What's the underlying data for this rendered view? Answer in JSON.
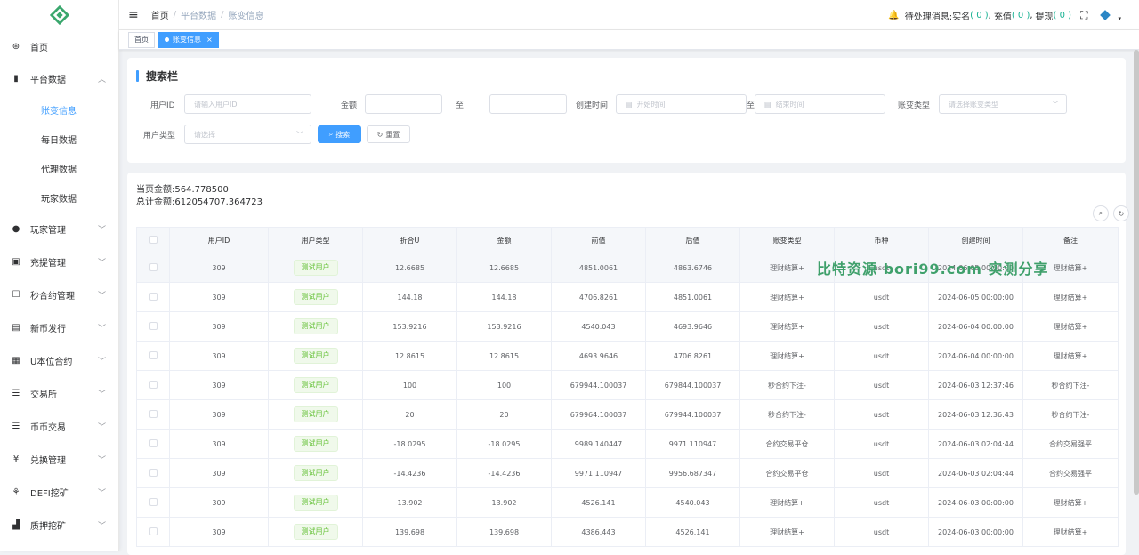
{
  "sidebar": {
    "items": [
      {
        "label": "首页",
        "icon": "dashboard-icon"
      },
      {
        "label": "平台数据",
        "icon": "chart-icon",
        "expanded": true,
        "children": [
          "账变信息",
          "每日数据",
          "代理数据",
          "玩家数据"
        ]
      },
      {
        "label": "玩家管理",
        "icon": "user-icon"
      },
      {
        "label": "充提管理",
        "icon": "wallet-icon"
      },
      {
        "label": "秒合约管理",
        "icon": "contract-icon"
      },
      {
        "label": "新币发行",
        "icon": "coin-icon"
      },
      {
        "label": "U本位合约",
        "icon": "grid-icon"
      },
      {
        "label": "交易所",
        "icon": "list-icon"
      },
      {
        "label": "币币交易",
        "icon": "list2-icon"
      },
      {
        "label": "兑换管理",
        "icon": "yen-icon"
      },
      {
        "label": "DEFI挖矿",
        "icon": "defi-icon"
      },
      {
        "label": "质押挖矿",
        "icon": "bar-chart-icon"
      }
    ],
    "active_sub": "账变信息"
  },
  "topbar": {
    "breadcrumb": [
      "首页",
      "平台数据",
      "账变信息"
    ],
    "pending_label": "待处理消息:",
    "realname_label": "实名",
    "realname_count": "( 0 )",
    "recharge_label": "充值",
    "recharge_count": "( 0 )",
    "withdraw_label": "提现",
    "withdraw_count": "( 0 )",
    "sep1": ",",
    "sep2": ","
  },
  "tags": {
    "home": "首页",
    "current": "账变信息"
  },
  "search": {
    "title": "搜索栏",
    "user_id_label": "用户ID",
    "user_id_placeholder": "请输入用户ID",
    "amount_label": "金额",
    "to_label": "至",
    "create_time_label": "创建时间",
    "start_placeholder": "开始时间",
    "end_placeholder": "结束时间",
    "change_type_label": "账变类型",
    "change_type_placeholder": "请选择账变类型",
    "user_type_label": "用户类型",
    "user_type_placeholder": "请选择",
    "search_btn": "搜索",
    "reset_btn": "重置"
  },
  "summary": {
    "page_amount": "当页金额:564.778500",
    "total_amount": "总计金额:612054707.364723"
  },
  "table": {
    "headers": [
      "用户ID",
      "用户类型",
      "折合U",
      "金额",
      "前值",
      "后值",
      "账变类型",
      "币种",
      "创建时间",
      "备注"
    ],
    "rows": [
      [
        "309",
        "测试用户",
        "12.6685",
        "12.6685",
        "4851.0061",
        "4863.6746",
        "理财结算+",
        "usdt",
        "2024-06-05 00:00:00",
        "理财结算+"
      ],
      [
        "309",
        "测试用户",
        "144.18",
        "144.18",
        "4706.8261",
        "4851.0061",
        "理财结算+",
        "usdt",
        "2024-06-05 00:00:00",
        "理财结算+"
      ],
      [
        "309",
        "测试用户",
        "153.9216",
        "153.9216",
        "4540.043",
        "4693.9646",
        "理财结算+",
        "usdt",
        "2024-06-04 00:00:00",
        "理财结算+"
      ],
      [
        "309",
        "测试用户",
        "12.8615",
        "12.8615",
        "4693.9646",
        "4706.8261",
        "理财结算+",
        "usdt",
        "2024-06-04 00:00:00",
        "理财结算+"
      ],
      [
        "309",
        "测试用户",
        "100",
        "100",
        "679944.100037",
        "679844.100037",
        "秒合约下注-",
        "usdt",
        "2024-06-03 12:37:46",
        "秒合约下注-"
      ],
      [
        "309",
        "测试用户",
        "20",
        "20",
        "679964.100037",
        "679944.100037",
        "秒合约下注-",
        "usdt",
        "2024-06-03 12:36:43",
        "秒合约下注-"
      ],
      [
        "309",
        "测试用户",
        "-18.0295",
        "-18.0295",
        "9989.140447",
        "9971.110947",
        "合约交易平仓",
        "usdt",
        "2024-06-03 02:04:44",
        "合约交易强平"
      ],
      [
        "309",
        "测试用户",
        "-14.4236",
        "-14.4236",
        "9971.110947",
        "9956.687347",
        "合约交易平仓",
        "usdt",
        "2024-06-03 02:04:44",
        "合约交易强平"
      ],
      [
        "309",
        "测试用户",
        "13.902",
        "13.902",
        "4526.141",
        "4540.043",
        "理财结算+",
        "usdt",
        "2024-06-03 00:00:00",
        "理财结算+"
      ],
      [
        "309",
        "测试用户",
        "139.698",
        "139.698",
        "4386.443",
        "4526.141",
        "理财结算+",
        "usdt",
        "2024-06-03 00:00:00",
        "理财结算+"
      ]
    ]
  },
  "watermark": "比特资源 bori99.com 实测分享",
  "colors": {
    "primary": "#409eff",
    "tag_green": "#67c23a",
    "count_green": "#1ab394"
  }
}
